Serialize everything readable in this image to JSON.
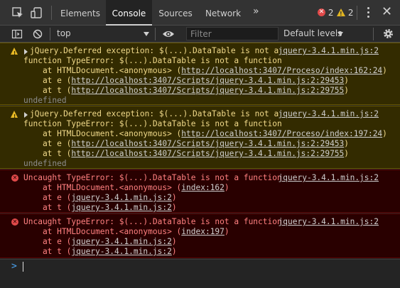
{
  "tabs": {
    "items": [
      {
        "label": "Elements"
      },
      {
        "label": "Console"
      },
      {
        "label": "Sources"
      },
      {
        "label": "Network"
      }
    ],
    "more": "»",
    "error_count": "2",
    "warning_count": "2",
    "close": "✕"
  },
  "toolbar": {
    "context": "top",
    "filter_placeholder": "Filter",
    "filter_value": "",
    "levels": "Default levels"
  },
  "messages": [
    {
      "level": "warning",
      "lines": [
        "jQuery.Deferred exception: $(...).DataTable is not a",
        "function TypeError: $(...).DataTable is not a function",
        "    at HTMLDocument.<anonymous> (",
        "    at e (",
        "    at t ("
      ],
      "links": [
        "http://localhost:3407/Proceso/index:162:24",
        "http://localhost:3407/Scripts/jquery-3.4.1.min.js:2:29453",
        "http://localhost:3407/Scripts/jquery-3.4.1.min.js:2:29755"
      ],
      "tail": "undefined",
      "source": "jquery-3.4.1.min.js:2"
    },
    {
      "level": "warning",
      "lines": [
        "jQuery.Deferred exception: $(...).DataTable is not a",
        "function TypeError: $(...).DataTable is not a function",
        "    at HTMLDocument.<anonymous> (",
        "    at e (",
        "    at t ("
      ],
      "links": [
        "http://localhost:3407/Proceso/index:197:24",
        "http://localhost:3407/Scripts/jquery-3.4.1.min.js:2:29453",
        "http://localhost:3407/Scripts/jquery-3.4.1.min.js:2:29755"
      ],
      "tail": "undefined",
      "source": "jquery-3.4.1.min.js:2"
    },
    {
      "level": "error",
      "lines": [
        "Uncaught TypeError: $(...).DataTable is not a function",
        "    at HTMLDocument.<anonymous> (",
        "    at e (",
        "    at t ("
      ],
      "links": [
        "index:162",
        "jquery-3.4.1.min.js:2",
        "jquery-3.4.1.min.js:2"
      ],
      "source": "jquery-3.4.1.min.js:2"
    },
    {
      "level": "error",
      "lines": [
        "Uncaught TypeError: $(...).DataTable is not a function",
        "    at HTMLDocument.<anonymous> (",
        "    at e (",
        "    at t ("
      ],
      "links": [
        "index:197",
        "jquery-3.4.1.min.js:2",
        "jquery-3.4.1.min.js:2"
      ],
      "source": "jquery-3.4.1.min.js:2"
    }
  ],
  "prompt": ">",
  "colors": {
    "warning_bg": "#332b00",
    "warning_text": "#f0d98a",
    "error_bg": "#290000",
    "error_text": "#ff8080",
    "prompt_accent": "#4ba3f0"
  }
}
